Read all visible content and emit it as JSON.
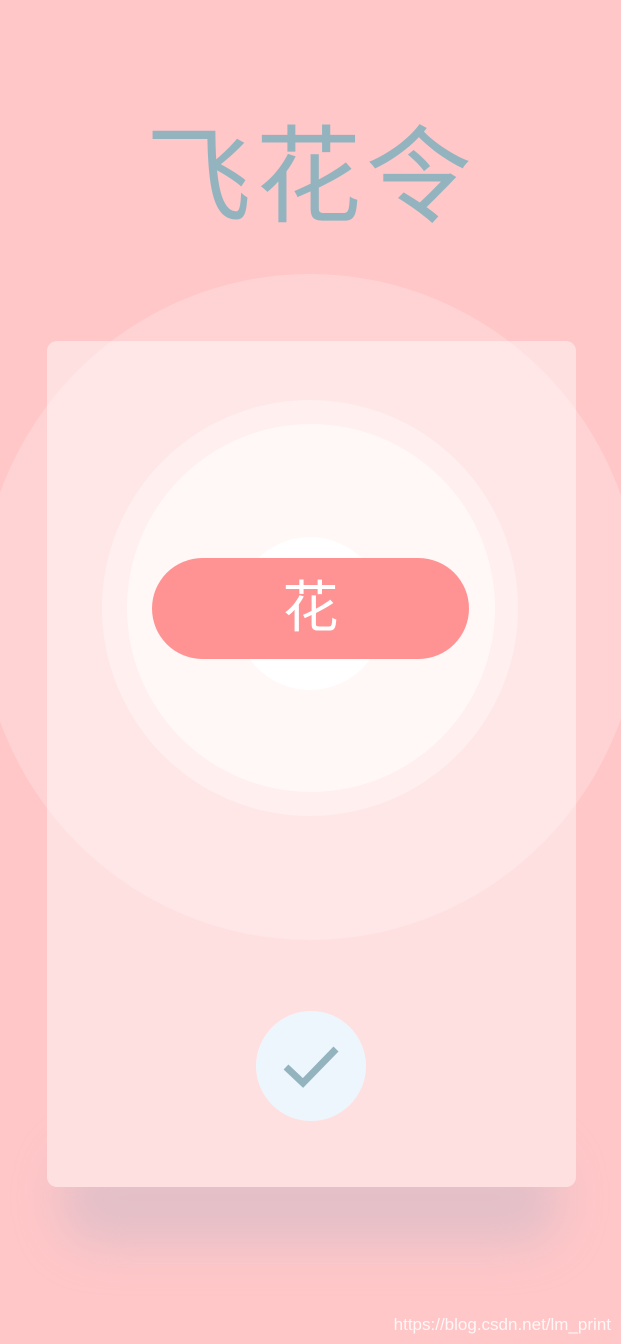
{
  "app": {
    "title": "飞花令"
  },
  "game": {
    "keyword": "花"
  },
  "actions": {
    "confirm_icon": "check-icon"
  },
  "watermark": {
    "text": "https://blog.csdn.net/lm_print"
  },
  "colors": {
    "background": "#ffc7c8",
    "card": "#ffe0e1",
    "accent": "#ff9394",
    "title": "#93b4bf",
    "confirm_button": "#eef6fd",
    "check": "#93b4bf"
  }
}
